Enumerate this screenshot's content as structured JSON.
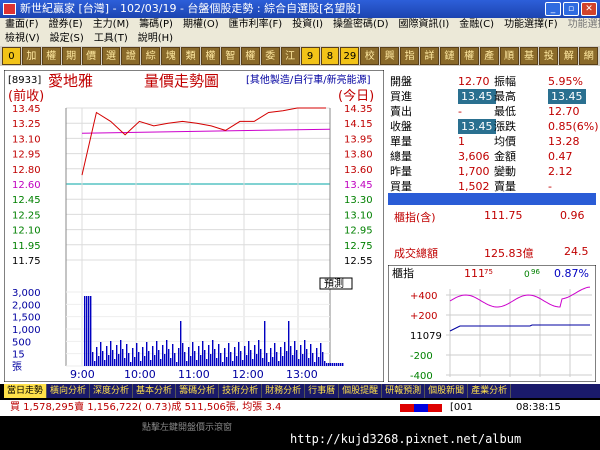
{
  "window": {
    "title": "新世紀贏家 [台灣] - 102/03/19 - 台盤個股走勢 : 綜合自選股[名望股]",
    "buttons": [
      "_",
      "▫",
      "✕"
    ]
  },
  "menu1": [
    "畫面(F)",
    "證券(E)",
    "主力(M)",
    "籌碼(P)",
    "期權(O)",
    "匯市利率(F)",
    "投資(I)",
    "操盤密碼(D)",
    "國際資訊(I)",
    "金融(C)",
    "功能選擇(F)",
    "功能選擇(F)"
  ],
  "menu2": [
    "檢視(V)",
    "設定(S)",
    "工具(T)",
    "說明(H)"
  ],
  "toolbar": [
    "0",
    "加",
    "權",
    "期",
    "價",
    "選",
    "證",
    "綜",
    "塊",
    "類",
    "權",
    "智",
    "權",
    "委",
    "江",
    "9",
    "8",
    "29",
    "校",
    "興",
    "指",
    "詳",
    "鏈",
    "權",
    "產",
    "順",
    "基",
    "投",
    "解",
    "網"
  ],
  "chart": {
    "code": "[8933]",
    "name": "愛地雅",
    "chart_title": "量價走勢圖",
    "sources": "[其他製造/自行車/新亮能源]",
    "left_tag": "(前收)",
    "right_tag": "(今日)",
    "yticks_left": [
      "13.45",
      "13.25",
      "13.10",
      "12.95",
      "12.80",
      "12.60",
      "12.45",
      "12.25",
      "12.10",
      "11.95",
      "11.75"
    ],
    "yticks_right": [
      "14.35",
      "14.15",
      "13.95",
      "13.80",
      "13.60",
      "13.45",
      "13.30",
      "13.10",
      "12.95",
      "12.75",
      "12.55"
    ],
    "vol_ticks": [
      "3,000",
      "2,000",
      "1,500",
      "1,000",
      "500",
      "15",
      "張"
    ],
    "xticks": [
      "9:00",
      "10:00",
      "11:00",
      "12:00",
      "13:00"
    ],
    "forecast_label": "預測",
    "prev_close_label": "12.60",
    "open_line": "11.75"
  },
  "chart_data": {
    "type": "line",
    "title": "量價走勢圖",
    "x": [
      "9:00",
      "9:15",
      "9:30",
      "9:45",
      "10:00",
      "10:15",
      "10:30",
      "10:45",
      "11:00",
      "11:15",
      "11:30",
      "11:45",
      "12:00",
      "12:15",
      "12:30",
      "12:45",
      "13:00",
      "13:30"
    ],
    "series": [
      {
        "values": [
          12.7,
          13.4,
          13.3,
          13.15,
          13.3,
          13.25,
          13.28,
          13.3,
          13.28,
          13.25,
          13.2,
          13.3,
          13.3,
          13.4,
          13.42,
          13.45,
          13.45,
          13.45
        ]
      }
    ],
    "ylim": [
      11.75,
      13.45
    ]
  },
  "quote": {
    "rows": [
      {
        "l1": "開盤",
        "v1": "12.70",
        "l2": "振幅",
        "v2": "5.95%"
      },
      {
        "l1": "買進",
        "v1": "13.45",
        "l2": "最高",
        "v2": "13.45"
      },
      {
        "l1": "賣出",
        "v1": "-",
        "l2": "最低",
        "v2": "12.70"
      },
      {
        "l1": "收盤",
        "v1": "13.45",
        "l2": "漲跌",
        "v2": "0.85(6%)"
      },
      {
        "l1": "單量",
        "v1": "1",
        "l2": "均價",
        "v2": "13.28"
      },
      {
        "l1": "總量",
        "v1": "3,606",
        "l2": "金額",
        "v2": "0.47"
      },
      {
        "l1": "昨量",
        "v1": "1,700",
        "l2": "變動",
        "v2": "2.12"
      },
      {
        "l1": "買量",
        "v1": "1,502",
        "l2": "賣量",
        "v2": "-"
      }
    ]
  },
  "index": {
    "label": "櫃指(含)",
    "value": "111.75",
    "change": "0.96",
    "volume_label": "成交總額",
    "volume": "125.83億",
    "volume_change": "24.5"
  },
  "mini": {
    "label": "櫃指",
    "price": "111",
    "price_frac": "75",
    "chg": "0",
    "chg_frac": "96",
    "pct": "0.87%",
    "ticks": [
      "+400",
      "+200",
      "11079",
      "-200",
      "-400"
    ]
  },
  "tabs": [
    "當日走勢",
    "橫向分析",
    "深度分析",
    "基本分析",
    "籌碼分析",
    "技術分析",
    "財務分析",
    "行事曆",
    "個股提醒",
    "研報預測",
    "個股新聞",
    "產業分析"
  ],
  "status": {
    "text": "買 1,578,295賣 1,156,722( 0.73)成 511,506張, 均張 3.4",
    "code": "[001",
    "time": "08:38:15",
    "ticker": "點擊左鍵開盤價示滾窗"
  },
  "footer": {
    "url": "http://kujd3268.pixnet.net/album"
  },
  "colors": {
    "price_line": "#d40000",
    "avg_line": "#cc00cc",
    "volume_bar": "#0000c0",
    "prev_close": "#00a6a6"
  }
}
